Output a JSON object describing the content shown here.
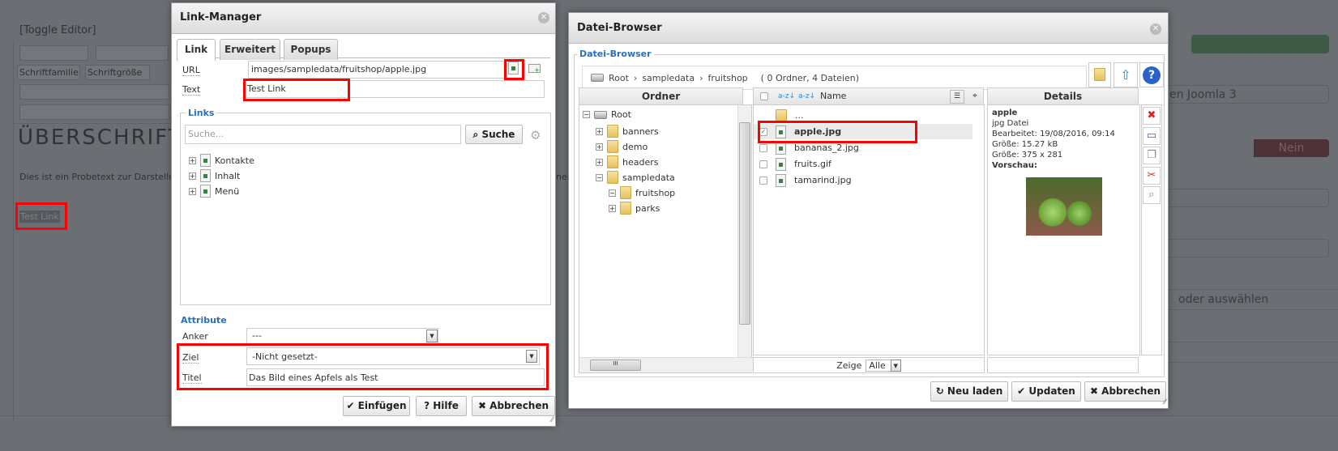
{
  "background": {
    "toggle_editor": "[Toggle Editor]",
    "font_family": "Schriftfamilie",
    "font_size": "Schriftgröße",
    "heading": "ÜBERSCHRIFT",
    "paragraph": "Dies ist ein Probetext zur Darstellu",
    "paragraph_tail": "ner",
    "link_text": "Test Link",
    "right_select_1": "en Joomla 3",
    "toggle_no": "Nein",
    "right_text": "oder auswählen",
    "colors": {
      "overlay": "#6b6e73",
      "green": "#3e5a46",
      "red": "#4d3136"
    }
  },
  "link_manager": {
    "title": "Link-Manager",
    "tabs": [
      {
        "label": "Link"
      },
      {
        "label": "Erweitert"
      },
      {
        "label": "Popups"
      }
    ],
    "url_label": "URL",
    "url_value": "images/sampledata/fruitshop/apple.jpg",
    "text_label": "Text",
    "text_value": "Test Link",
    "links_legend": "Links",
    "search_placeholder": "Suche...",
    "search_button": "Suche",
    "tree": [
      {
        "label": "Kontakte"
      },
      {
        "label": "Inhalt"
      },
      {
        "label": "Menü"
      }
    ],
    "attributes_heading": "Attribute",
    "anchor_label": "Anker",
    "anchor_value": "---",
    "target_label": "Ziel",
    "target_value": "-Nicht gesetzt-",
    "title_label": "Titel",
    "title_value": "Das Bild eines Apfels als Test",
    "buttons": {
      "insert": "Einfügen",
      "help": "Hilfe",
      "cancel": "Abbrechen"
    }
  },
  "file_browser": {
    "title": "Datei-Browser",
    "legend": "Datei-Browser",
    "breadcrumb": [
      "Root",
      "sampledata",
      "fruitshop"
    ],
    "summary": "( 0 Ordner, 4 Dateien)",
    "folders_header": "Ordner",
    "name_header": "Name",
    "details_header": "Details",
    "folders": [
      {
        "label": "Root",
        "level": 0,
        "expanded": true
      },
      {
        "label": "banners",
        "level": 1,
        "expanded": false
      },
      {
        "label": "demo",
        "level": 1,
        "expanded": false
      },
      {
        "label": "headers",
        "level": 1,
        "expanded": false
      },
      {
        "label": "sampledata",
        "level": 1,
        "expanded": true
      },
      {
        "label": "fruitshop",
        "level": 2,
        "expanded": true
      },
      {
        "label": "parks",
        "level": 2,
        "expanded": false
      }
    ],
    "files": [
      {
        "name": "...",
        "checked": false,
        "selected": false
      },
      {
        "name": "apple.jpg",
        "checked": true,
        "selected": true
      },
      {
        "name": "bananas_2.jpg",
        "checked": false,
        "selected": false
      },
      {
        "name": "fruits.gif",
        "checked": false,
        "selected": false
      },
      {
        "name": "tamarind.jpg",
        "checked": false,
        "selected": false
      }
    ],
    "details": {
      "name": "apple",
      "type": "jpg Datei",
      "modified": "Bearbeitet: 19/08/2016, 09:14",
      "size": "Größe: 15.27 kB",
      "dimensions": "Größe: 375 x 281",
      "preview_label": "Vorschau:"
    },
    "show_label": "Zeige",
    "show_value": "Alle",
    "buttons": {
      "reload": "Neu laden",
      "update": "Updaten",
      "cancel": "Abbrechen"
    }
  }
}
